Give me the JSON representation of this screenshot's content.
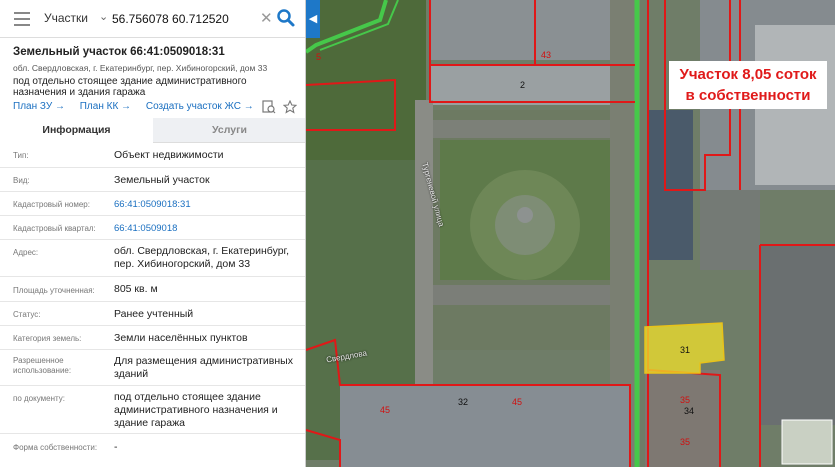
{
  "search": {
    "type_label": "Участки",
    "query": "56.756078 60.712520"
  },
  "object": {
    "title": "Земельный участок 66:41:0509018:31",
    "address": "обл. Свердловская, г. Екатеринбург, пер. Хибиногорский, дом 33",
    "description": "под отдельно стоящее здание административного назначения и здания гаража",
    "links": [
      "План ЗУ →",
      "План КК →",
      "Создать участок ЖС →"
    ]
  },
  "tabs": [
    "Информация",
    "Услуги"
  ],
  "properties": [
    {
      "label": "Тип:",
      "value": "Объект недвижимости",
      "link": false
    },
    {
      "label": "Вид:",
      "value": "Земельный участок",
      "link": false
    },
    {
      "label": "Кадастровый номер:",
      "value": "66:41:0509018:31",
      "link": true
    },
    {
      "label": "Кадастровый квартал:",
      "value": "66:41:0509018",
      "link": true
    },
    {
      "label": "Адрес:",
      "value": "обл. Свердловская, г. Екатеринбург, пер. Хибиногорский, дом 33",
      "link": false
    },
    {
      "label": "Площадь уточненная:",
      "value": "805 кв. м",
      "link": false
    },
    {
      "label": "Статус:",
      "value": "Ранее учтенный",
      "link": false
    },
    {
      "label": "Категория земель:",
      "value": "Земли населённых пунктов",
      "link": false
    },
    {
      "label": "Разрешенное использование:",
      "value": "Для размещения административных зданий",
      "link": false
    },
    {
      "label": "по документу:",
      "value": "под отдельно стоящее здание административного назначения и здание гаража",
      "link": false
    },
    {
      "label": "Форма собственности:",
      "value": "-",
      "link": false
    }
  ],
  "map": {
    "annotation_line1": "Участок 8,05 соток",
    "annotation_line2": "в собственности",
    "parcel_labels": [
      "43",
      "2",
      "31",
      "35",
      "34",
      "35",
      "32",
      "45",
      "45",
      "5"
    ],
    "street_labels": [
      "Тургеневой улица",
      "Свердлова"
    ],
    "highlight_color": "#f2e12a",
    "boundary_color": "#e01818",
    "road_color": "#46c84a"
  },
  "colors": {
    "accent": "#1e78c8",
    "link": "#1a6fc0"
  }
}
